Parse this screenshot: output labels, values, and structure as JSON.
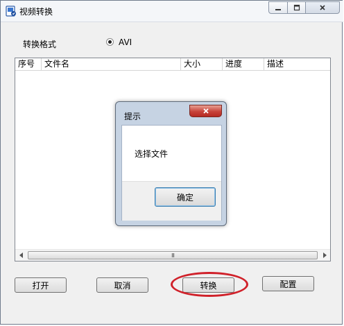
{
  "window": {
    "title": "视频转换",
    "icon": "app-icon",
    "controls": {
      "minimize_icon": "minimize-icon",
      "maximize_icon": "maximize-icon",
      "close_icon": "close-icon"
    }
  },
  "format": {
    "label": "转换格式",
    "option": "AVI",
    "selected": true
  },
  "list": {
    "columns": [
      "序号",
      "文件名",
      "大小",
      "进度",
      "描述"
    ],
    "rows": [],
    "scroll_grip": "III"
  },
  "buttons": {
    "open": "打开",
    "cancel": "取消",
    "convert": "转换",
    "config": "配置"
  },
  "annotation": {
    "highlight_color": "#d0212a"
  },
  "dialog": {
    "title": "提示",
    "message": "选择文件",
    "ok": "确定"
  }
}
